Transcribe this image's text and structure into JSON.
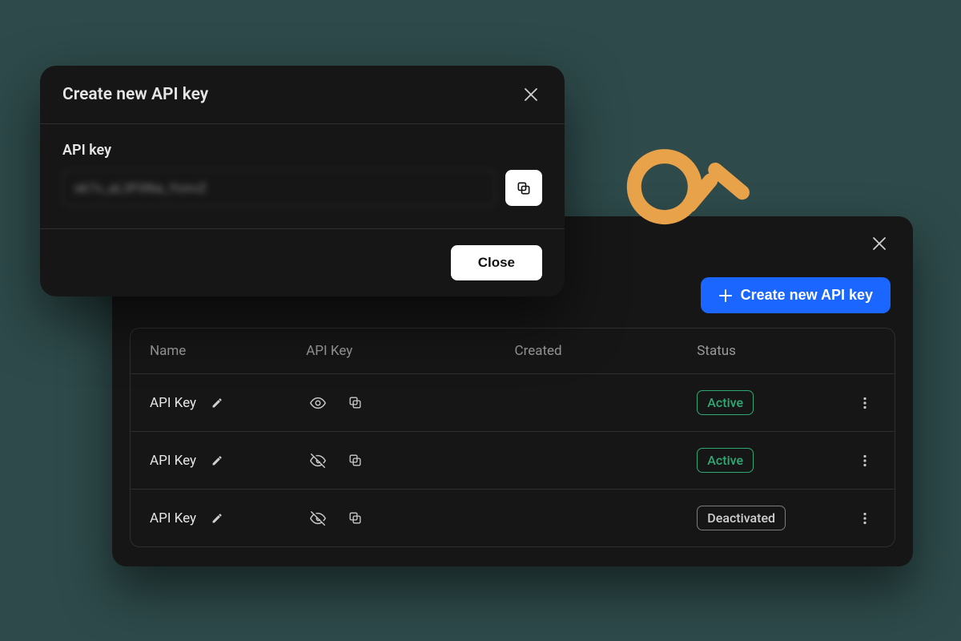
{
  "create_dialog": {
    "title": "Create new API key",
    "field_label": "API key",
    "field_value": "sk7v_aL3F0Na_YonvZ",
    "close_button": "Close"
  },
  "list_dialog": {
    "create_button": "Create new API key",
    "columns": {
      "name": "Name",
      "key": "API Key",
      "created": "Created",
      "status": "Status"
    },
    "rows": [
      {
        "name": "API Key",
        "status": "Active",
        "status_class": "active",
        "eye": "open"
      },
      {
        "name": "API Key",
        "status": "Active",
        "status_class": "active",
        "eye": "closed"
      },
      {
        "name": "API Key",
        "status": "Deactivated",
        "status_class": "deactivated",
        "eye": "closed"
      }
    ]
  }
}
